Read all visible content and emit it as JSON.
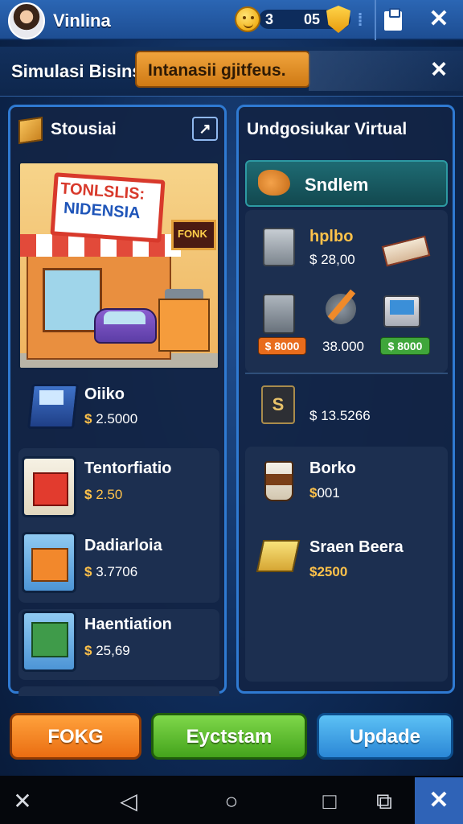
{
  "topbar": {
    "username": "Vinlina",
    "coins": "3",
    "gems": "05"
  },
  "subheader": {
    "title": "Simulasi Bisins",
    "banner": "Intanasii gjitfeus.",
    "close_icon": "×"
  },
  "left_panel": {
    "title": "Stousiai",
    "edit_icon": "↗",
    "shop_image": {
      "sign_line1": "TONLSLIS:",
      "sign_line2": "NIDENSIA",
      "side_sign": "FONK"
    },
    "featured": {
      "name": "Oiiko",
      "price": "2.5000"
    },
    "items": [
      {
        "name": "Tentorfiatio",
        "price": "2.50"
      },
      {
        "name": "Dadiarloia",
        "price": "3.7706"
      },
      {
        "name": "Haentiation",
        "price": "25,69"
      }
    ],
    "currency_symbol": "$"
  },
  "right_panel": {
    "title": "Undgosiukar Virtual",
    "banner": "Sndlem",
    "tools_item": {
      "name": "hplbo",
      "price": "28,00"
    },
    "price_tags": [
      "$ 8000",
      "38.000",
      "$ 8000"
    ],
    "stock": {
      "letter": "S",
      "price": "13.5266"
    },
    "items": [
      {
        "name": "Borko",
        "price": "001"
      },
      {
        "name": "Sraen Beera",
        "price": "2500"
      }
    ],
    "currency_symbol": "$"
  },
  "buttons": {
    "left": "FOKG",
    "middle": "Eyctstam",
    "right": "Updade"
  },
  "nav": {
    "tools": "✕",
    "back": "◁",
    "home": "○",
    "recents": "□",
    "screenshot": "⧉",
    "active": "✕"
  },
  "colors": {
    "accent_blue": "#2f7ad2",
    "button_orange": "#ea6d12",
    "button_green": "#44a31c",
    "button_blue": "#2b87d6",
    "price_gold": "#ffc24a"
  },
  "icons": [
    "avatar",
    "smile-coin-icon",
    "shield-icon",
    "clipboard-icon",
    "tools-icon",
    "close-icon",
    "box-icon",
    "edit-icon",
    "cash-register-icon",
    "gift-icon",
    "hand-money-icon",
    "safe-icon",
    "book-icon",
    "calculator-icon",
    "pen-icon",
    "laptop-icon",
    "coffee-cup-icon",
    "ticket-icon"
  ]
}
